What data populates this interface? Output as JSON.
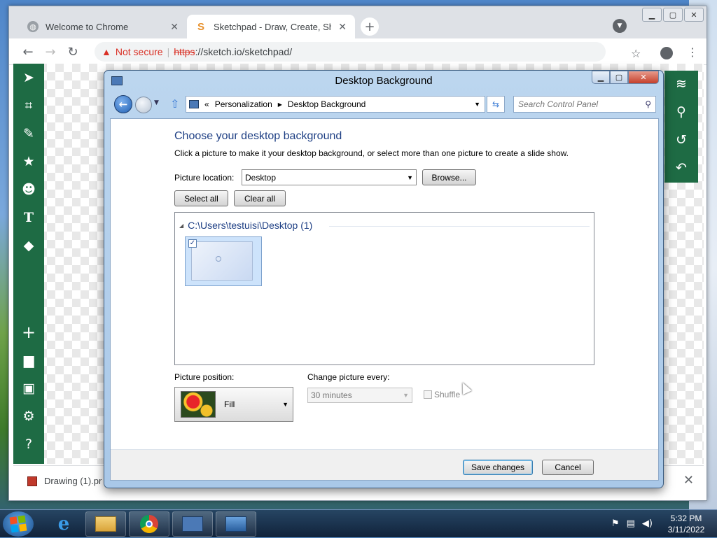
{
  "chrome": {
    "tabs": [
      {
        "title": "Welcome to Chrome",
        "active": false
      },
      {
        "title": "Sketchpad - Draw, Create, Share!",
        "active": true
      }
    ],
    "security_label": "Not secure",
    "url_scheme": "https",
    "url_rest": "://sketch.io/sketchpad/"
  },
  "sketchpad": {
    "left_tools": [
      "pointer-icon",
      "crop-icon",
      "brush-icon",
      "star-icon",
      "emoji-icon",
      "text-icon",
      "fill-icon",
      "add-icon",
      "folder-icon",
      "save-icon",
      "settings-icon",
      "help-icon"
    ],
    "right_tools": [
      "layers-icon",
      "search-icon",
      "history-icon",
      "undo-icon"
    ],
    "accent": "#1e6b44"
  },
  "download": {
    "filename": "Drawing (1).pr"
  },
  "dialog": {
    "title": "Desktop Background",
    "breadcrumb_prefix": "«",
    "breadcrumb": [
      "Personalization",
      "Desktop Background"
    ],
    "search_placeholder": "Search Control Panel",
    "heading": "Choose your desktop background",
    "instructions": "Click a picture to make it your desktop background, or select more than one picture to create a slide show.",
    "picture_location_label": "Picture location:",
    "picture_location_value": "Desktop",
    "browse_label": "Browse...",
    "select_all_label": "Select all",
    "clear_all_label": "Clear all",
    "group_title": "C:\\Users\\testuisi\\Desktop (1)",
    "thumbnail_checked": true,
    "picture_position_label": "Picture position:",
    "picture_position_value": "Fill",
    "change_every_label": "Change picture every:",
    "change_every_value": "30 minutes",
    "shuffle_label": "Shuffle",
    "save_label": "Save changes",
    "cancel_label": "Cancel"
  },
  "taskbar": {
    "time": "5:32 PM",
    "date": "3/11/2022"
  }
}
